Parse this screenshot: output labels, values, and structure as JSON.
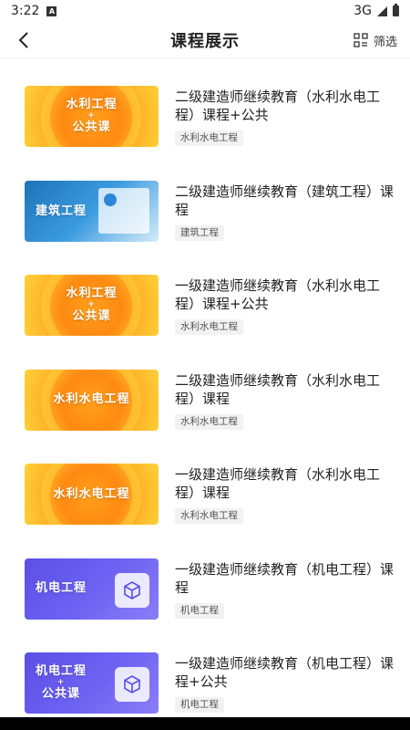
{
  "status": {
    "time": "3:22",
    "network": "3G"
  },
  "header": {
    "title": "课程展示",
    "filter_label": "筛选"
  },
  "courses": [
    {
      "title": "二级建造师继续教育（水利水电工程）课程+公共",
      "tag": "水利水电工程",
      "thumb": {
        "style": "orange",
        "line1": "水利工程",
        "plus": "+",
        "line2": "公共课"
      }
    },
    {
      "title": "二级建造师继续教育（建筑工程）课程",
      "tag": "建筑工程",
      "thumb": {
        "style": "blue",
        "line1": "建筑工程",
        "plus": "",
        "line2": ""
      }
    },
    {
      "title": "一级建造师继续教育（水利水电工程）课程+公共",
      "tag": "水利水电工程",
      "thumb": {
        "style": "orange",
        "line1": "水利工程",
        "plus": "+",
        "line2": "公共课"
      }
    },
    {
      "title": "二级建造师继续教育（水利水电工程）课程",
      "tag": "水利水电工程",
      "thumb": {
        "style": "orange",
        "line1": "水利水电工程",
        "plus": "",
        "line2": ""
      }
    },
    {
      "title": "一级建造师继续教育（水利水电工程）课程",
      "tag": "水利水电工程",
      "thumb": {
        "style": "orange",
        "line1": "水利水电工程",
        "plus": "",
        "line2": ""
      }
    },
    {
      "title": "一级建造师继续教育（机电工程）课程",
      "tag": "机电工程",
      "thumb": {
        "style": "purple",
        "line1": "机电工程",
        "plus": "",
        "line2": ""
      }
    },
    {
      "title": "一级建造师继续教育（机电工程）课程+公共",
      "tag": "机电工程",
      "thumb": {
        "style": "purple",
        "line1": "机电工程",
        "plus": "+",
        "line2": "公共课"
      }
    }
  ]
}
